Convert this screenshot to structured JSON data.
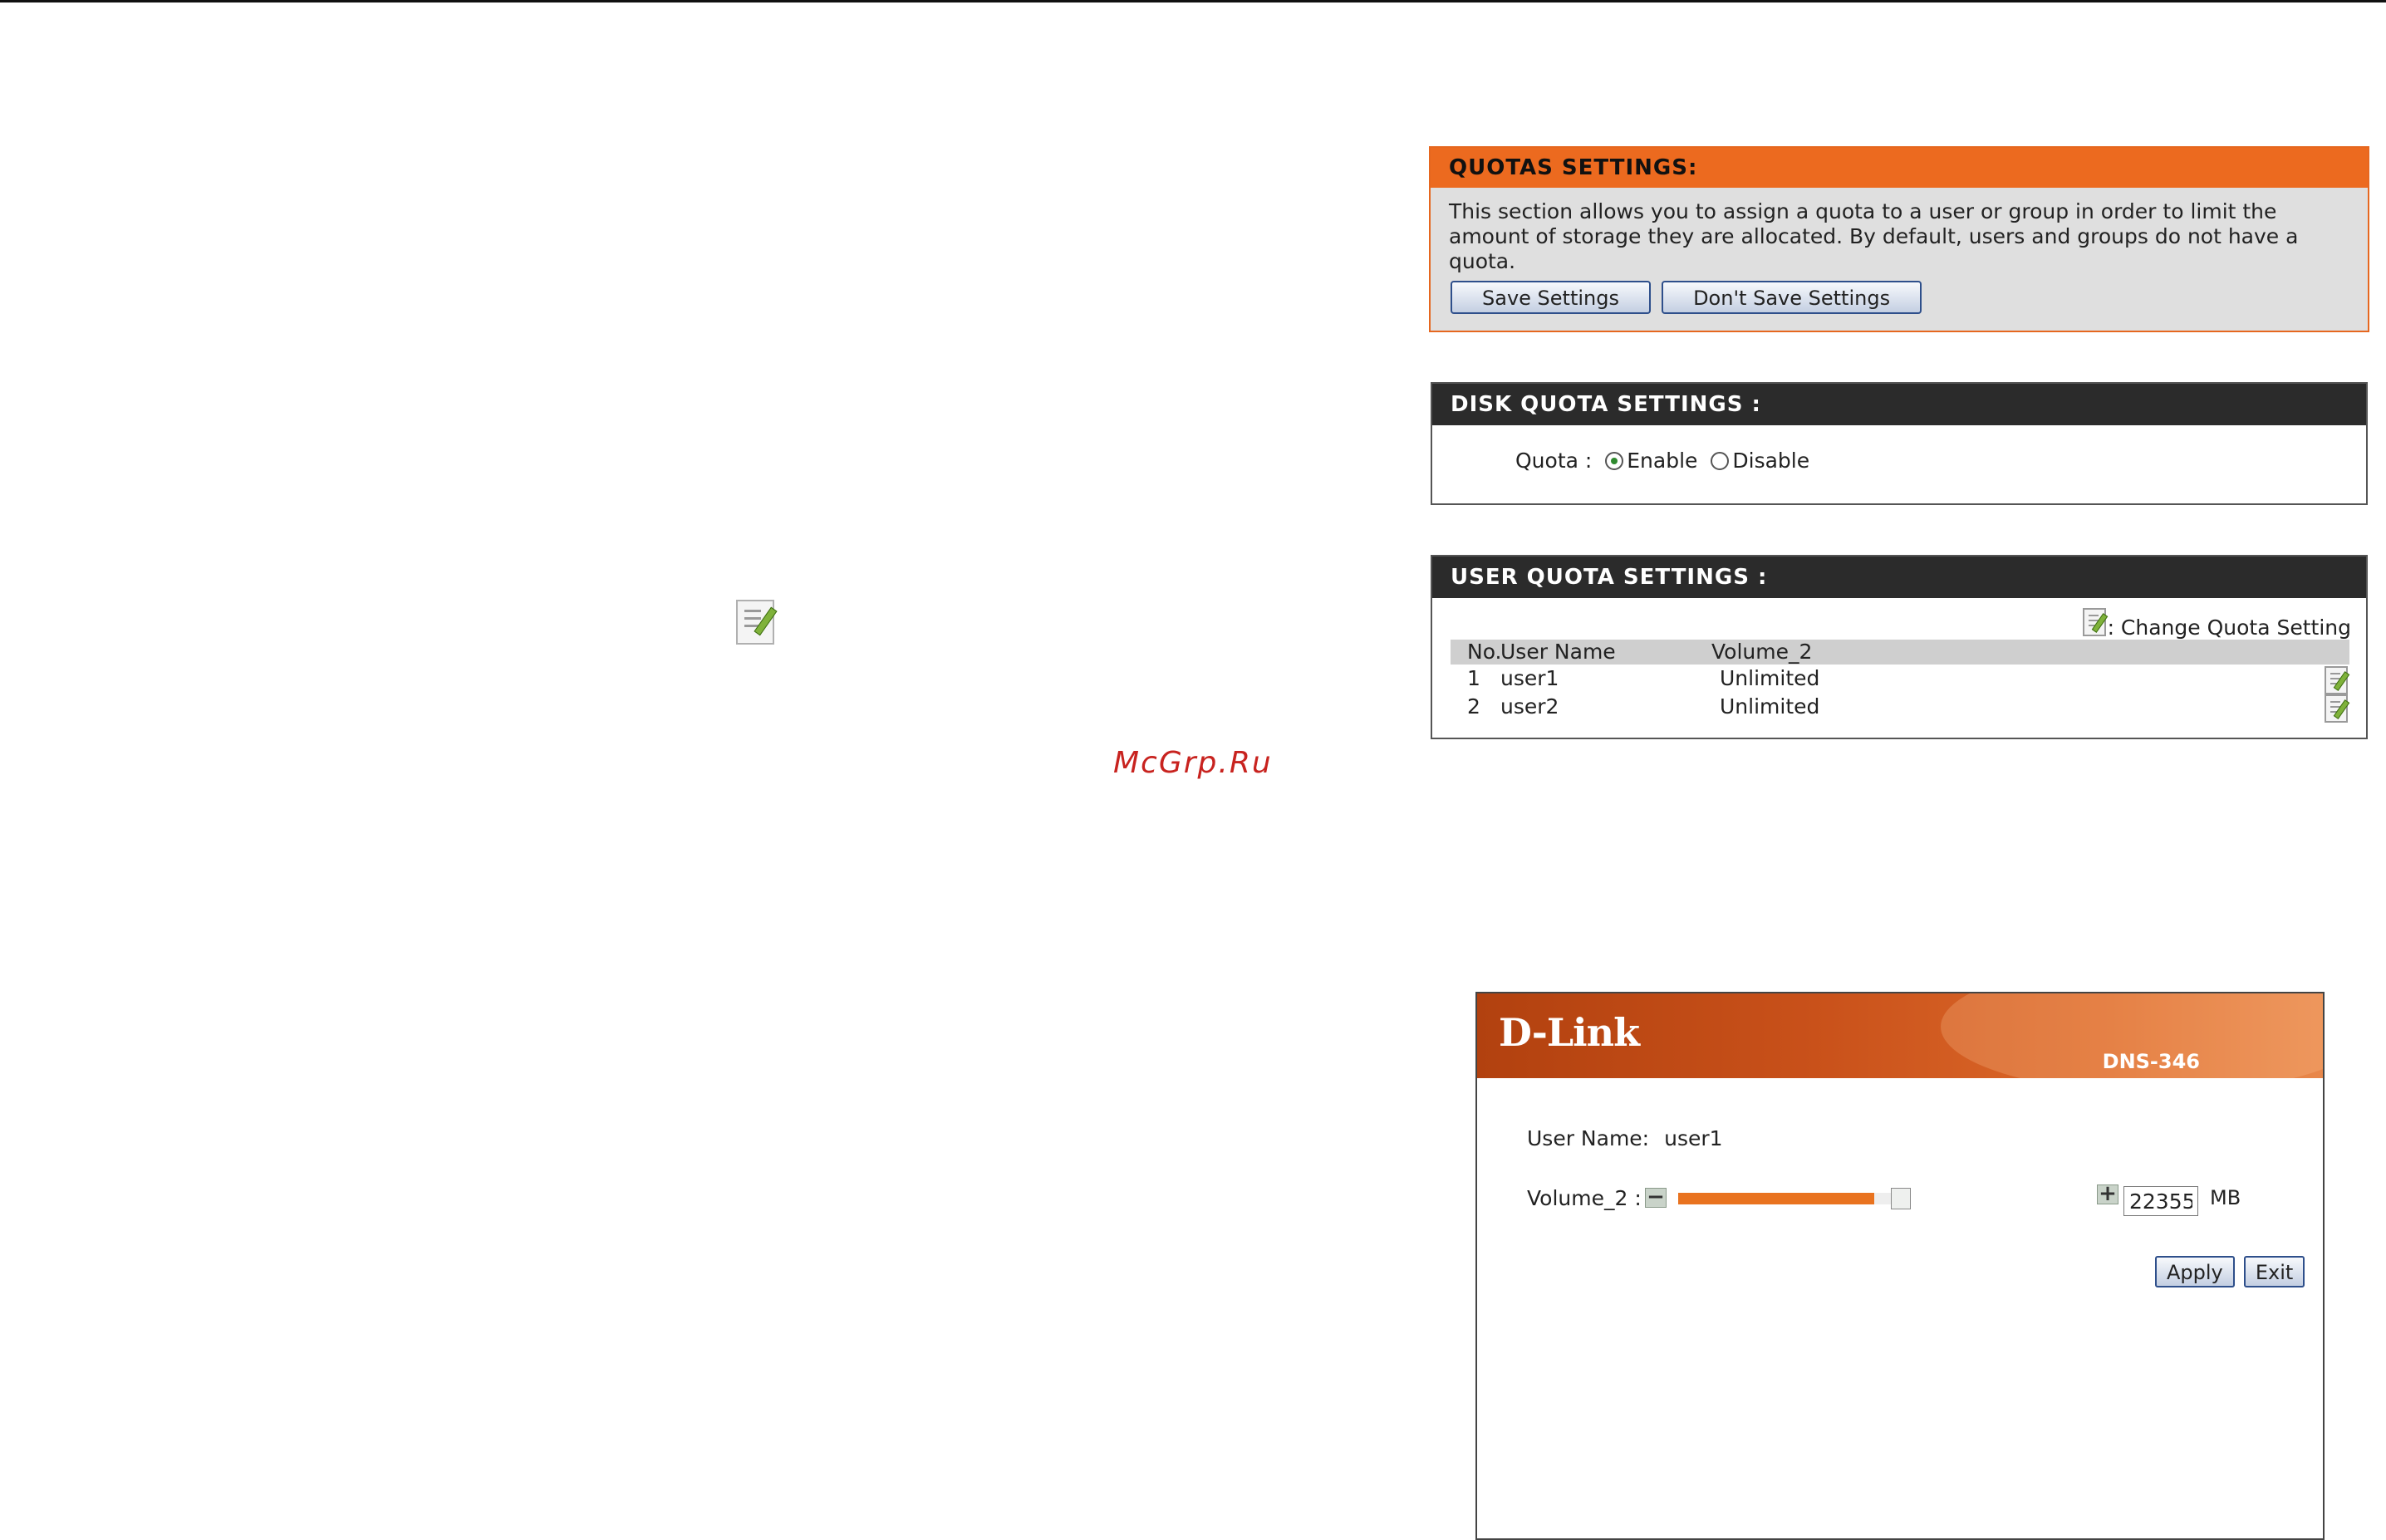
{
  "watermark": "McGrp.Ru",
  "quotas_settings": {
    "title": "QUOTAS SETTINGS:",
    "description": "This section allows you to assign a quota to a user or group in order to limit the amount of storage they are allocated. By default, users and groups do not have a quota.",
    "save_label": "Save Settings",
    "dont_save_label": "Don't Save Settings"
  },
  "disk_quota": {
    "title": "DISK QUOTA SETTINGS :",
    "quota_label": "Quota :",
    "enable_label": "Enable",
    "disable_label": "Disable",
    "selected": "Enable"
  },
  "user_quota": {
    "title": "USER QUOTA SETTINGS :",
    "legend": ": Change Quota Setting",
    "columns": {
      "no": "No.",
      "name": "User Name",
      "volume": "Volume_2"
    },
    "rows": [
      {
        "no": "1",
        "name": "user1",
        "volume": "Unlimited"
      },
      {
        "no": "2",
        "name": "user2",
        "volume": "Unlimited"
      }
    ]
  },
  "dlink_popup": {
    "logo": "D-Link",
    "model": "DNS-346",
    "user_label": "User Name:",
    "user_value": "user1",
    "volume_label": "Volume_2 :",
    "volume_value": "22355",
    "volume_unit": "MB",
    "volume_fill_fraction": 0.92,
    "apply_label": "Apply",
    "exit_label": "Exit"
  },
  "colors": {
    "orange_accent": "#ec6a1f",
    "dark_header": "#2b2b2b",
    "panel_gray": "#dfdfdf"
  }
}
